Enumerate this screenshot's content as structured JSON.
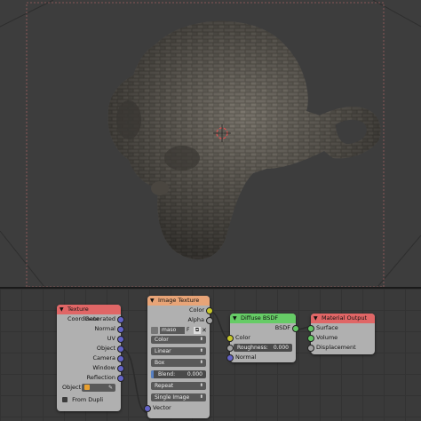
{
  "viewport": {
    "background": "#3d3d3d"
  },
  "nodes": {
    "texcoord": {
      "title": "Texture Coordinate",
      "outputs": [
        "Generated",
        "Normal",
        "UV",
        "Object",
        "Camera",
        "Window",
        "Reflection"
      ],
      "object_label": "Object",
      "from_dupli": "From Dupli",
      "color": "#e06666"
    },
    "imagetex": {
      "title": "Image Texture",
      "outputs": [
        "Color",
        "Alpha"
      ],
      "image_name": "maso",
      "image_suffix": "F",
      "color_space": "Color",
      "interpolation": "Linear",
      "projection": "Box",
      "blend_label": "Blend:",
      "blend_value": "0.000",
      "extension": "Repeat",
      "source": "Single Image",
      "input_vector": "Vector",
      "color": "#e8a477"
    },
    "diffuse": {
      "title": "Diffuse BSDF",
      "output": "BSDF",
      "input_color": "Color",
      "roughness_label": "Roughness:",
      "roughness_value": "0.000",
      "input_normal": "Normal",
      "color": "#66cc66"
    },
    "matout": {
      "title": "Material Output",
      "inputs": [
        "Surface",
        "Volume",
        "Displacement"
      ],
      "color": "#e06666"
    }
  }
}
